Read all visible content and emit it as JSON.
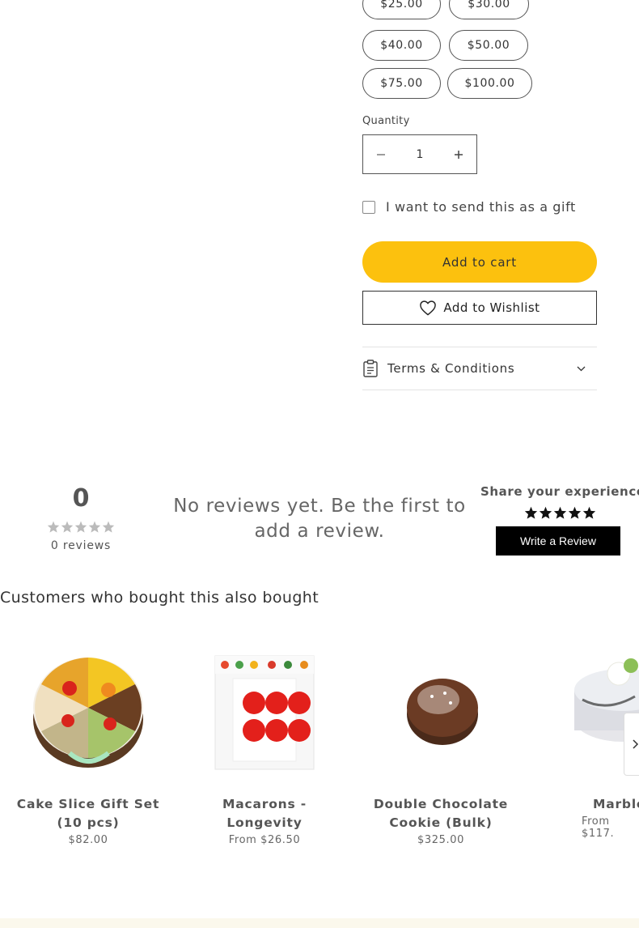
{
  "gift_card": {
    "amounts": [
      "$25.00",
      "$30.00",
      "$40.00",
      "$50.00",
      "$75.00",
      "$100.00"
    ]
  },
  "quantity": {
    "label": "Quantity",
    "value": "1",
    "decrease_icon": "minus-icon",
    "increase_icon": "plus-icon"
  },
  "gift_option": {
    "label": "I want to send this as a gift",
    "checked": false
  },
  "actions": {
    "add_to_cart": "Add to cart",
    "add_to_wishlist": "Add to Wishlist",
    "accent_color": "#fcc10e"
  },
  "accordion": {
    "terms_label": "Terms & Conditions"
  },
  "reviews": {
    "average": "0",
    "count_label": "0 reviews",
    "empty_message": "No reviews yet. Be the first to add a review.",
    "share_title": "Share your experience",
    "write_review": "Write a Review"
  },
  "also_bought": {
    "title": "Customers who bought this also bought",
    "products": [
      {
        "name": "Cake Slice Gift Set (10 pcs)",
        "price": "$82.00"
      },
      {
        "name": "Macarons - Longevity",
        "price": "From $26.50"
      },
      {
        "name": "Double Chocolate Cookie (Bulk)",
        "price": "$325.00"
      },
      {
        "name": "Marble",
        "price": "From $117."
      }
    ]
  }
}
